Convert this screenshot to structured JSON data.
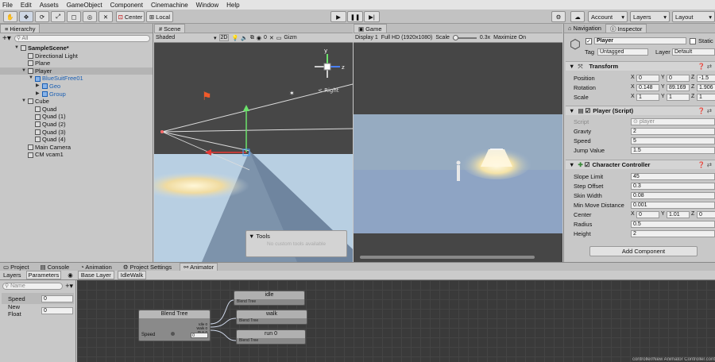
{
  "menu": [
    "File",
    "Edit",
    "Assets",
    "GameObject",
    "Component",
    "Cinemachine",
    "Window",
    "Help"
  ],
  "toolbar": {
    "center": "Center",
    "local": "Local",
    "account": "Account",
    "layers": "Layers",
    "layout": "Layout"
  },
  "hierarchy": {
    "tab": "Hierarchy",
    "search_placeholder": "All",
    "items": [
      {
        "label": "SampleScene*",
        "depth": 0,
        "bold": true,
        "arrow": "▼"
      },
      {
        "label": "Directional Light",
        "depth": 1
      },
      {
        "label": "Plane",
        "depth": 1
      },
      {
        "label": "Player",
        "depth": 1,
        "arrow": "▼",
        "selected": true
      },
      {
        "label": "BlueSuitFree01",
        "depth": 2,
        "arrow": "▼",
        "blue": true
      },
      {
        "label": "Geo",
        "depth": 3,
        "arrow": "▶",
        "blue": true
      },
      {
        "label": "Group",
        "depth": 3,
        "arrow": "▶",
        "blue": true
      },
      {
        "label": "Cube",
        "depth": 1,
        "arrow": "▼"
      },
      {
        "label": "Quad",
        "depth": 2
      },
      {
        "label": "Quad (1)",
        "depth": 2
      },
      {
        "label": "Quad (2)",
        "depth": 2
      },
      {
        "label": "Quad (3)",
        "depth": 2
      },
      {
        "label": "Quad (4)",
        "depth": 2
      },
      {
        "label": "Main Camera",
        "depth": 1
      },
      {
        "label": "CM vcam1",
        "depth": 1
      }
    ]
  },
  "scene": {
    "tab": "Scene",
    "shading": "Shaded",
    "mode2d": "2D",
    "gizmos": "Gizm",
    "hidden_count": "0",
    "persp_label": "< Right",
    "tools_title": "Tools",
    "tools_empty": "No custom tools available"
  },
  "game": {
    "tab": "Game",
    "display": "Display 1",
    "resolution": "Full HD (1920x1080)",
    "scale_label": "Scale",
    "scale_value": "0.3x",
    "maximize": "Maximize On"
  },
  "inspector": {
    "tabs": [
      "Navigation",
      "Inspector"
    ],
    "object_name": "Player",
    "static": "Static",
    "tag_label": "Tag",
    "tag": "Untagged",
    "layer_label": "Layer",
    "layer": "Default",
    "transform": {
      "title": "Transform",
      "position_label": "Position",
      "rotation_label": "Rotation",
      "scale_label": "Scale",
      "position": [
        "0",
        "0",
        "-1.5"
      ],
      "rotation": [
        "0.148",
        "89.169",
        "1.906"
      ],
      "scale": [
        "1",
        "1",
        "1"
      ]
    },
    "script_comp": {
      "title": "Player (Script)",
      "script_label": "Script",
      "script_value": "player",
      "gravity_label": "Gravty",
      "gravity": "2",
      "speed_label": "Speed",
      "speed": "5",
      "jump_label": "Jump Value",
      "jump": "1.5"
    },
    "controller": {
      "title": "Character Controller",
      "slope_label": "Slope Limit",
      "slope": "45",
      "step_label": "Step Offset",
      "step": "0.3",
      "skin_label": "Skin Width",
      "skin": "0.08",
      "minmove_label": "Min Move Distance",
      "minmove": "0.001",
      "center_label": "Center",
      "center": [
        "0",
        "1.01",
        "0"
      ],
      "radius_label": "Radius",
      "radius": "0.5",
      "height_label": "Height",
      "height": "2"
    },
    "add_component": "Add Component"
  },
  "bottom": {
    "tabs": [
      "Project",
      "Console",
      "Animation",
      "Project Settings",
      "Animator"
    ],
    "subtabs": {
      "layers": "Layers",
      "parameters": "Parameters"
    },
    "breadcrumb": [
      "Base Layer",
      "IdleWalk"
    ],
    "name_placeholder": "Name",
    "params": [
      {
        "name": "Speed",
        "value": "0"
      },
      {
        "name": "New Float",
        "value": "0"
      }
    ],
    "blend_tree": {
      "title": "Blend Tree",
      "param": "Speed",
      "value": "0",
      "outputs": [
        "Idle 0",
        "Walk 0",
        "Run 0"
      ]
    },
    "motions": [
      {
        "title": "idle",
        "sub": "Blend Tree"
      },
      {
        "title": "walk",
        "sub": "Blend Tree"
      },
      {
        "title": "run 0",
        "sub": "Blend Tree"
      }
    ],
    "footer": "controller/New Animator Controller.cont"
  },
  "colors": {
    "scene_sky": "#474747",
    "ground": "#a9c4de",
    "game_sky": "#8fa6be",
    "game_ground": "#8ea4c4"
  }
}
